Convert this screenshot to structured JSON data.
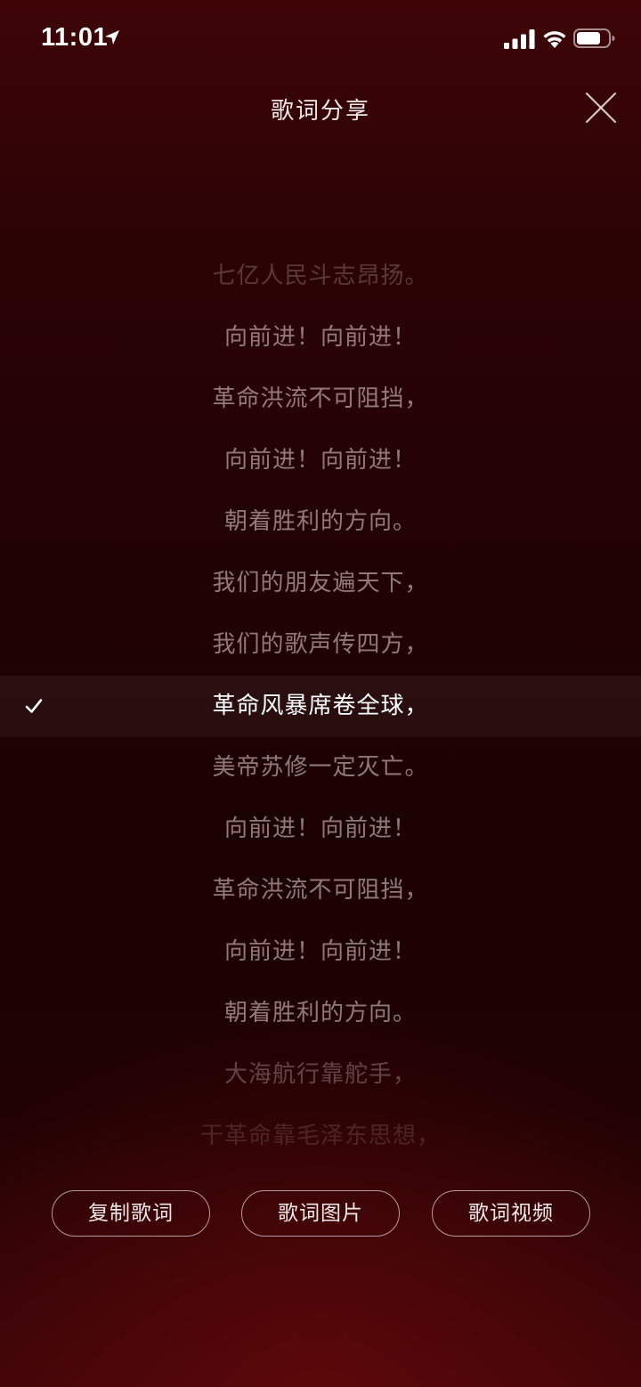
{
  "status_bar": {
    "time": "11:01",
    "icons": [
      "location-arrow-icon",
      "cellular-signal-icon",
      "wifi-icon",
      "battery-icon"
    ]
  },
  "header": {
    "title": "歌词分享",
    "close_icon": "close-icon"
  },
  "lyrics": {
    "selected_index": 7,
    "lines": [
      {
        "text": "七亿人民斗志昂扬。"
      },
      {
        "text": "向前进！向前进！"
      },
      {
        "text": "革命洪流不可阻挡，"
      },
      {
        "text": "向前进！向前进！"
      },
      {
        "text": "朝着胜利的方向。"
      },
      {
        "text": "我们的朋友遍天下，"
      },
      {
        "text": "我们的歌声传四方，"
      },
      {
        "text": "革命风暴席卷全球，"
      },
      {
        "text": "美帝苏修一定灭亡。"
      },
      {
        "text": "向前进！向前进！"
      },
      {
        "text": "革命洪流不可阻挡，"
      },
      {
        "text": "向前进！向前进！"
      },
      {
        "text": "朝着胜利的方向。"
      },
      {
        "text": "大海航行靠舵手，"
      },
      {
        "text": "干革命靠毛泽东思想，"
      }
    ]
  },
  "actions": {
    "copy_lyrics": "复制歌词",
    "lyrics_image": "歌词图片",
    "lyrics_video": "歌词视频"
  },
  "colors": {
    "background_top": "#3e0507",
    "background_mid": "#1c0103",
    "background_bottom": "#3a0508",
    "text_primary": "#ffffff",
    "text_dim": "#d7c3c3"
  }
}
